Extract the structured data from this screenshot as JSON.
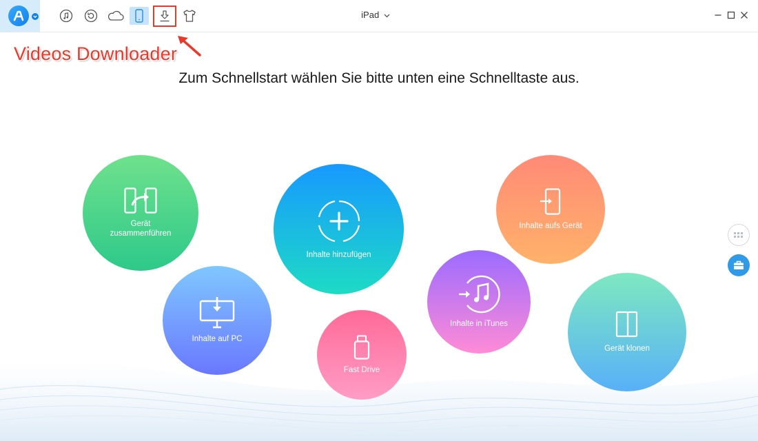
{
  "topbar": {
    "device_name": "iPad",
    "tools": [
      {
        "icon": "music-note-icon"
      },
      {
        "icon": "backup-restore-icon"
      },
      {
        "icon": "cloud-icon"
      },
      {
        "icon": "phone-device-icon"
      },
      {
        "icon": "download-icon"
      },
      {
        "icon": "tshirt-icon"
      }
    ]
  },
  "annotation": {
    "label": "Videos Downloader",
    "color": "#e8392a"
  },
  "headline": "Zum Schnellstart wählen Sie bitte unten eine Schnelltaste aus.",
  "quick_actions": [
    {
      "id": "merge",
      "label": "Gerät zusammenführen",
      "icon": "merge-devices-icon"
    },
    {
      "id": "add",
      "label": "Inhalte hinzufügen",
      "icon": "plus-icon"
    },
    {
      "id": "to-device",
      "label": "Inhalte aufs Gerät",
      "icon": "to-device-icon"
    },
    {
      "id": "to-pc",
      "label": "Inhalte auf PC",
      "icon": "monitor-download-icon"
    },
    {
      "id": "fast-drive",
      "label": "Fast Drive",
      "icon": "usb-drive-icon"
    },
    {
      "id": "to-itunes",
      "label": "Inhalte in iTunes",
      "icon": "itunes-icon"
    },
    {
      "id": "clone",
      "label": "Gerät klonen",
      "icon": "clone-device-icon"
    }
  ],
  "colors": {
    "accent": "#1281e8",
    "merge": [
      "#6ee28f",
      "#2dc98a"
    ],
    "add": [
      "#1e9bff",
      "#19dcc6"
    ],
    "to_device": [
      "#ff8a78",
      "#ffb06a"
    ],
    "to_pc": [
      "#7fc6ff",
      "#6a7cff"
    ],
    "fast_drive": [
      "#ff6f9c",
      "#ff9cc5"
    ],
    "to_itunes": [
      "#9b6cff",
      "#ff8ad8"
    ],
    "clone": [
      "#7ee7c0",
      "#58b3f7"
    ]
  }
}
